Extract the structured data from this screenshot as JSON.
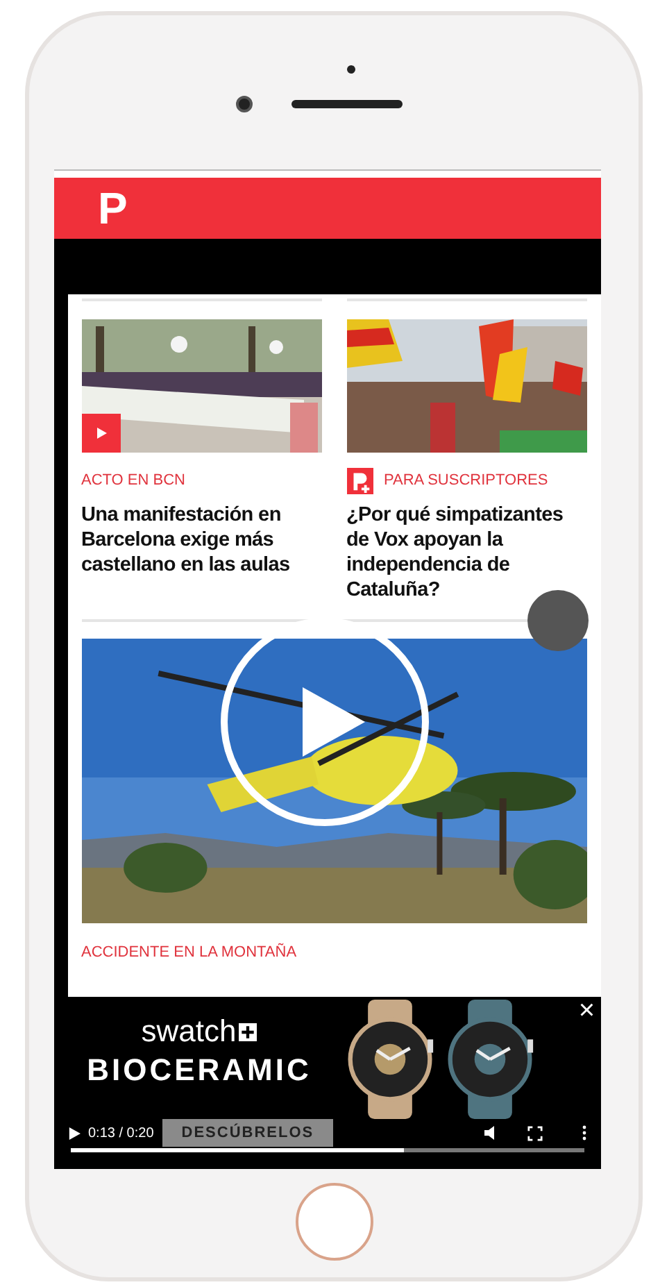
{
  "header": {
    "logo": "P"
  },
  "articles": [
    {
      "kind": "video",
      "tag": "ACTO EN BCN",
      "headline": "Una manifestación en Barcelona exige más castellano en las aulas"
    },
    {
      "kind": "premium",
      "tag": "PARA SUSCRIPTORES",
      "headline": "¿Por qué simpatizantes de Vox apoyan la independencia de Cataluña?"
    }
  ],
  "featured": {
    "tag": "ACCIDENTE EN LA MONTAÑA"
  },
  "ad": {
    "brand": "swatch",
    "title": "BIOCERAMIC",
    "cta": "DESCÚBRELOS",
    "time": "0:13 / 0:20",
    "level": 0.65,
    "close": "×"
  }
}
